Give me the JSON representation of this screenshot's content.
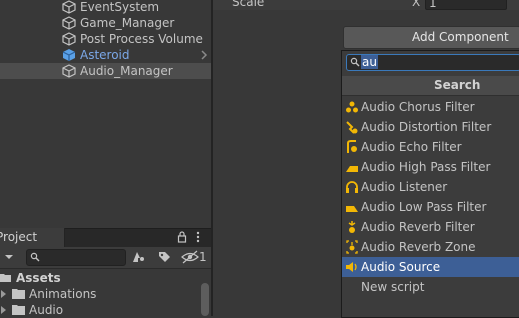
{
  "hierarchy": {
    "items": [
      {
        "label": "EventSystem"
      },
      {
        "label": "Game_Manager"
      },
      {
        "label": "Post Process Volume"
      },
      {
        "label": "Asteroid"
      },
      {
        "label": "Audio_Manager"
      }
    ]
  },
  "inspector": {
    "scale_label": "Scale",
    "x_label": "X",
    "x_value": "1"
  },
  "add_component": {
    "button_label": "Add Component",
    "search_value": "au",
    "header": "Search",
    "items": [
      {
        "label": "Audio Chorus Filter",
        "icon": "audio-chorus-filter-icon"
      },
      {
        "label": "Audio Distortion Filter",
        "icon": "audio-distortion-filter-icon"
      },
      {
        "label": "Audio Echo Filter",
        "icon": "audio-echo-filter-icon"
      },
      {
        "label": "Audio High Pass Filter",
        "icon": "audio-high-pass-filter-icon"
      },
      {
        "label": "Audio Listener",
        "icon": "headphones-icon"
      },
      {
        "label": "Audio Low Pass Filter",
        "icon": "audio-low-pass-filter-icon"
      },
      {
        "label": "Audio Reverb Filter",
        "icon": "audio-reverb-filter-icon"
      },
      {
        "label": "Audio Reverb Zone",
        "icon": "audio-reverb-zone-icon"
      },
      {
        "label": "Audio Source",
        "icon": "speaker-icon"
      },
      {
        "label": "New script",
        "icon": ""
      }
    ],
    "selected_index": 8
  },
  "project": {
    "tab_label": "Project",
    "hidden_count": "1",
    "tree": [
      {
        "label": "Assets"
      },
      {
        "label": "Animations"
      },
      {
        "label": "Audio"
      }
    ]
  },
  "colors": {
    "accent": "#3d5f96",
    "icon_yellow": "#f2b705",
    "selected_text": "#7ba8e8"
  }
}
